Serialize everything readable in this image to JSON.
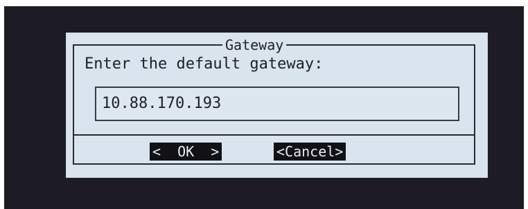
{
  "dialog": {
    "title": "Gateway",
    "prompt": "Enter the default gateway:",
    "input_value": "10.88.170.193"
  },
  "buttons": {
    "ok_label": "<  OK  >",
    "cancel_label": "<Cancel>"
  },
  "colors": {
    "terminal_background": "#1d1b24",
    "dialog_background": "#d9e4ee",
    "button_background": "#111116",
    "button_text": "#e8eef4"
  }
}
